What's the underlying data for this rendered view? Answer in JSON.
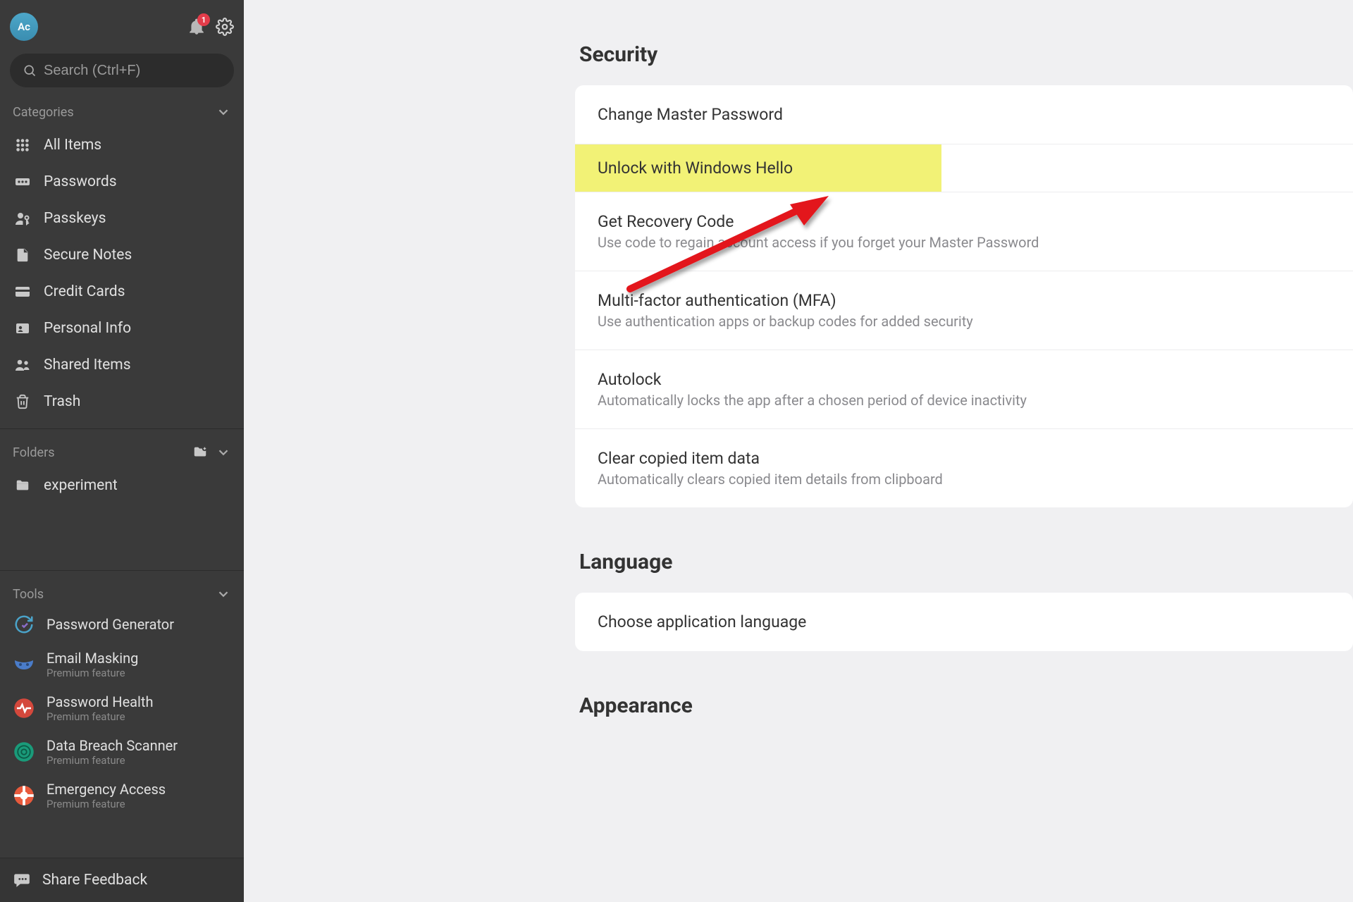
{
  "avatar_initials": "Ac",
  "notifications_count": "1",
  "search": {
    "placeholder": "Search (Ctrl+F)"
  },
  "sidebar": {
    "categories_label": "Categories",
    "items": [
      {
        "label": "All Items"
      },
      {
        "label": "Passwords"
      },
      {
        "label": "Passkeys"
      },
      {
        "label": "Secure Notes"
      },
      {
        "label": "Credit Cards"
      },
      {
        "label": "Personal Info"
      },
      {
        "label": "Shared Items"
      },
      {
        "label": "Trash"
      }
    ],
    "folders_label": "Folders",
    "folders": [
      {
        "label": "experiment"
      }
    ],
    "tools_label": "Tools",
    "tools": [
      {
        "label": "Password Generator",
        "sub": ""
      },
      {
        "label": "Email Masking",
        "sub": "Premium feature"
      },
      {
        "label": "Password Health",
        "sub": "Premium feature"
      },
      {
        "label": "Data Breach Scanner",
        "sub": "Premium feature"
      },
      {
        "label": "Emergency Access",
        "sub": "Premium feature"
      }
    ],
    "feedback_label": "Share Feedback"
  },
  "main": {
    "sections": {
      "security": {
        "title": "Security",
        "rows": [
          {
            "title": "Change Master Password",
            "desc": ""
          },
          {
            "title": "Unlock with Windows Hello",
            "desc": "",
            "highlighted": true
          },
          {
            "title": "Get Recovery Code",
            "desc": "Use code to regain account access if you forget your Master Password"
          },
          {
            "title": "Multi-factor authentication (MFA)",
            "desc": "Use authentication apps or backup codes for added security"
          },
          {
            "title": "Autolock",
            "desc": "Automatically locks the app after a chosen period of device inactivity"
          },
          {
            "title": "Clear copied item data",
            "desc": "Automatically clears copied item details from clipboard"
          }
        ]
      },
      "language": {
        "title": "Language",
        "rows": [
          {
            "title": "Choose application language",
            "desc": ""
          }
        ]
      },
      "appearance": {
        "title": "Appearance"
      }
    }
  }
}
